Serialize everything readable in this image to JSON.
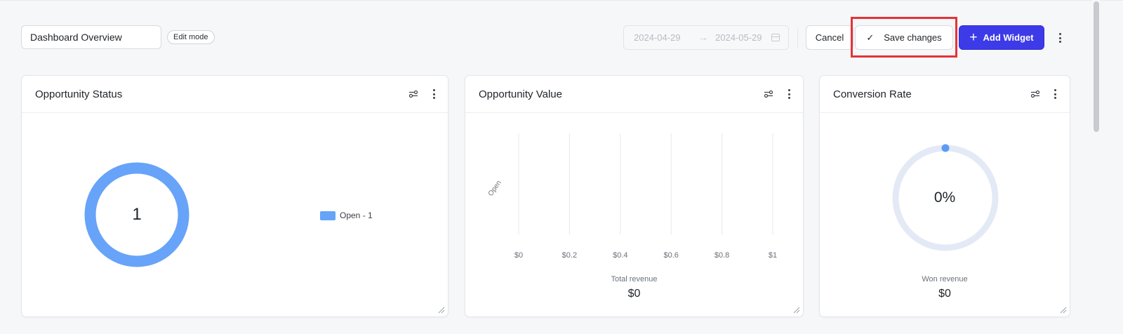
{
  "header": {
    "dashboard_title": "Dashboard Overview",
    "mode_badge": "Edit mode",
    "date_start": "2024-04-29",
    "date_arrow": "→",
    "date_end": "2024-05-29",
    "cancel_label": "Cancel",
    "save_label": "Save changes",
    "add_widget_label": "Add Widget",
    "highlight_color": "#e53238",
    "accent_color": "#3d3ae8",
    "icons": [
      "check-icon",
      "plus-icon",
      "kebab-menu-icon",
      "calendar-icon",
      "filter-settings-icon",
      "resize-handle-icon"
    ]
  },
  "widgets": {
    "status": {
      "title": "Opportunity Status",
      "center_value": "1",
      "legend_label": "Open - 1",
      "color": "#67a3f8"
    },
    "value": {
      "title": "Opportunity Value",
      "metric_label": "Total revenue",
      "metric_value": "$0"
    },
    "conversion": {
      "title": "Conversion Rate",
      "center_value": "0%",
      "metric_label": "Won revenue",
      "metric_value": "$0",
      "track_color": "#e4e9f6",
      "dot_color": "#5b9cf6"
    }
  },
  "chart_data": [
    {
      "type": "pie",
      "categories": [
        "Open"
      ],
      "values": [
        1
      ],
      "colors": [
        "#67a3f8"
      ],
      "legend": "right"
    },
    {
      "type": "bar",
      "orientation": "horizontal",
      "categories": [
        "Open"
      ],
      "values": [
        0
      ],
      "xticks": [
        "$0",
        "$0.2",
        "$0.4",
        "$0.6",
        "$0.8",
        "$1"
      ],
      "xlim": [
        0,
        1
      ],
      "grid": true
    }
  ]
}
